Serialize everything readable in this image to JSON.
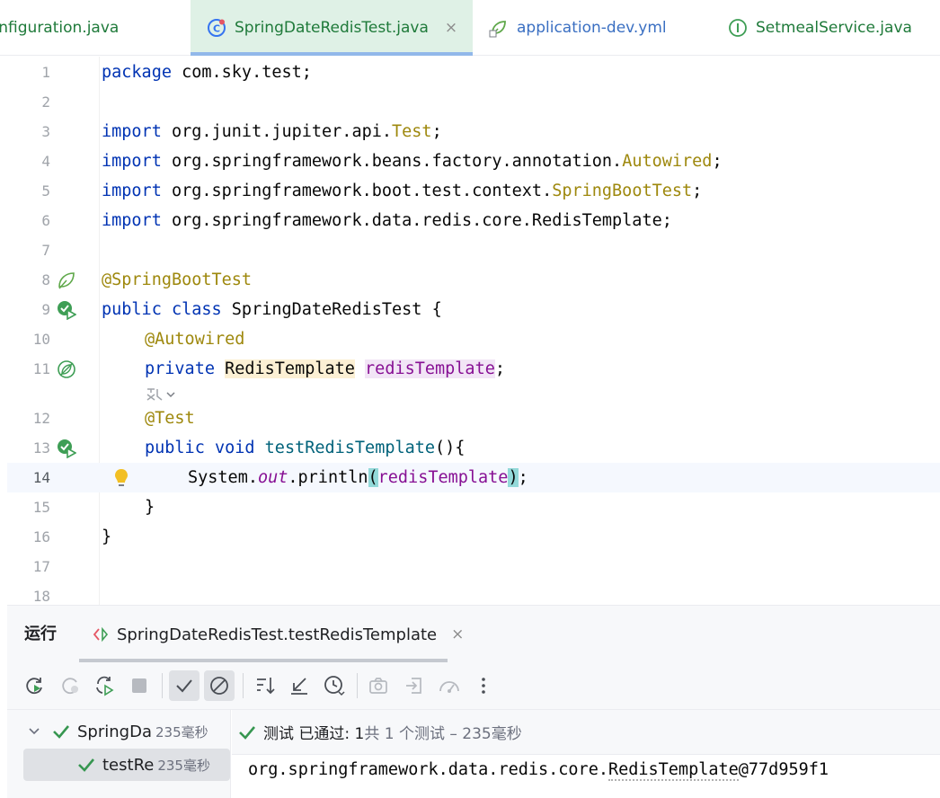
{
  "tabs": [
    {
      "label": "Configuration.java",
      "active": false,
      "icon": "class-icon"
    },
    {
      "label": "SpringDateRedisTest.java",
      "active": true,
      "icon": "test-class-icon",
      "close": "×"
    },
    {
      "label": "application-dev.yml",
      "active": false,
      "icon": "spring-yaml-icon"
    },
    {
      "label": "SetmealService.java",
      "active": false,
      "icon": "interface-icon"
    }
  ],
  "editor": {
    "line_numbers": [
      "1",
      "2",
      "3",
      "4",
      "5",
      "6",
      "7",
      "8",
      "9",
      "10",
      "11",
      "12",
      "13",
      "14",
      "15",
      "16",
      "17",
      "18"
    ],
    "code": {
      "l1_kw": "package",
      "l1_rest": " com.sky.test;",
      "l3_kw": "import",
      "l3_pkg": " org.junit.jupiter.api.",
      "l3_type": "Test",
      "l3_end": ";",
      "l4_kw": "import",
      "l4_pkg": " org.springframework.beans.factory.annotation.",
      "l4_type": "Autowired",
      "l4_end": ";",
      "l5_kw": "import",
      "l5_pkg": " org.springframework.boot.test.context.",
      "l5_type": "SpringBootTest",
      "l5_end": ";",
      "l6_kw": "import",
      "l6_rest": " org.springframework.data.redis.core.RedisTemplate;",
      "l8_ann": "@SpringBootTest",
      "l9_kw": "public class",
      "l9_name": " SpringDateRedisTest ",
      "l9_brace": "{",
      "l10_ann": "@Autowired",
      "l11_kw": "private",
      "l11_type": "RedisTemplate",
      "l11_field": "redisTemplate",
      "l11_end": ";",
      "l12_ann": "@Test",
      "l13_kw": "public void",
      "l13_fn": "testRedisTemplate",
      "l13_rest": "(){",
      "l14_sys": "System.",
      "l14_out": "out",
      "l14_println": ".println",
      "l14_open": "(",
      "l14_arg": "redisTemplate",
      "l14_close": ")",
      "l14_end": ";",
      "l15": "}",
      "l16": "}"
    }
  },
  "run_panel": {
    "title": "运行",
    "tab_label": "SpringDateRedisTest.testRedisTemplate",
    "tab_close": "×",
    "tree": [
      {
        "name": "SpringDa",
        "time": "235毫秒",
        "expanded": true
      },
      {
        "name": "testRe",
        "time": "235毫秒",
        "selected": true
      }
    ],
    "status_label": "测试 已通过: 1",
    "status_count": "共 1 个测试 – 235毫秒",
    "output_prefix": "org.springframework.data.redis.core.",
    "output_class": "RedisTemplate",
    "output_suffix": "@77d959f1"
  },
  "colors": {
    "active_tab_bg": "#dff1e6",
    "keyword": "#0033b3",
    "annotation": "#9e880d",
    "field": "#871094",
    "method": "#00627a",
    "pass_green": "#369650"
  }
}
